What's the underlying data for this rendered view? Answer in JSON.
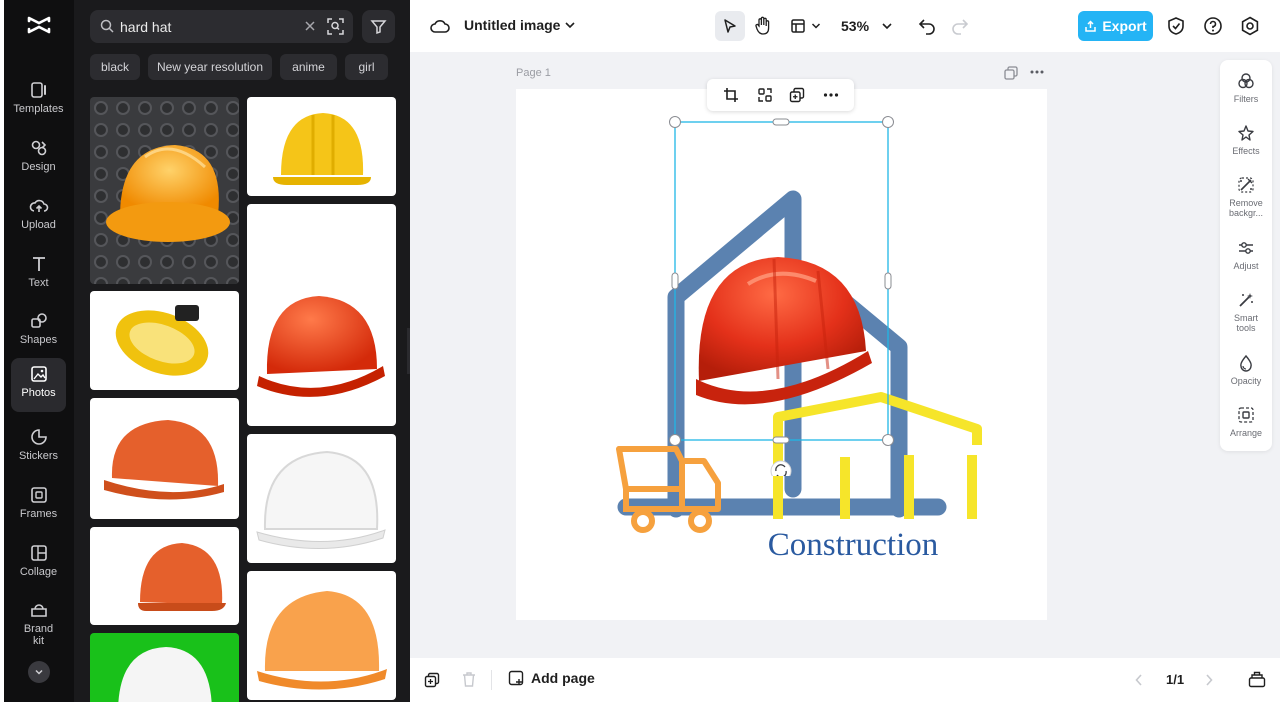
{
  "rail": {
    "items": [
      {
        "label": "Templates",
        "icon": "templates-icon"
      },
      {
        "label": "Design",
        "icon": "design-icon"
      },
      {
        "label": "Upload",
        "icon": "upload-cloud-icon"
      },
      {
        "label": "Text",
        "icon": "text-icon"
      },
      {
        "label": "Shapes",
        "icon": "shapes-icon"
      },
      {
        "label": "Photos",
        "icon": "photos-icon",
        "active": true
      },
      {
        "label": "Stickers",
        "icon": "stickers-icon"
      },
      {
        "label": "Frames",
        "icon": "frames-icon"
      },
      {
        "label": "Collage",
        "icon": "collage-icon"
      },
      {
        "label": "Brand kit",
        "icon": "brand-kit-icon"
      }
    ]
  },
  "panel": {
    "search": {
      "value": "hard hat"
    },
    "chips": [
      "black",
      "New year resolution",
      "anime",
      "girl"
    ],
    "photos": [
      "orange hard hat on dark surface",
      "yellow hard hat",
      "yellow hard hat tilted",
      "red hard hat",
      "orange worn hard hat",
      "white hard hat",
      "orange hard hat small",
      "orange hard hat",
      "white hard hat on green"
    ]
  },
  "topbar": {
    "title": "Untitled image",
    "zoom": "53%",
    "export_label": "Export"
  },
  "workspace": {
    "page_label": "Page 1",
    "design_text": "Construction"
  },
  "right_panel": {
    "items": [
      {
        "label": "Filters",
        "icon": "filters-icon"
      },
      {
        "label": "Effects",
        "icon": "effects-icon"
      },
      {
        "label": "Remove backgr...",
        "icon": "remove-background-icon"
      },
      {
        "label": "Adjust",
        "icon": "adjust-icon"
      },
      {
        "label": "Smart tools",
        "icon": "smart-tools-icon"
      },
      {
        "label": "Opacity",
        "icon": "opacity-icon"
      },
      {
        "label": "Arrange",
        "icon": "arrange-icon"
      }
    ]
  },
  "bottombar": {
    "add_page_label": "Add page",
    "page_count": "1/1"
  },
  "colors": {
    "accent": "#24b4f5",
    "selection": "#1fb6e6",
    "building_blue": "#5b82b0",
    "truck_orange": "#f6a13e",
    "roof_yellow": "#f6e52a",
    "text_blue": "#2a5aa0"
  }
}
